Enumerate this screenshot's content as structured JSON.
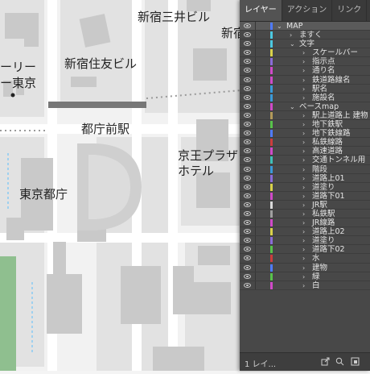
{
  "map": {
    "labels": {
      "mitsui": "新宿三井ビル",
      "shinjuku_cut": "新宿",
      "sumitomo": "新宿住友ビル",
      "ri_cut": "ーリー",
      "tokyo_cut": "ー東京",
      "station": "都庁前駅",
      "keio_line1": "京王プラザ",
      "keio_line2": "ホテル",
      "tocho": "東京都庁"
    }
  },
  "layers_panel": {
    "tabs": [
      "レイヤー",
      "アクション",
      "リンク"
    ],
    "active_tab": "レイヤー",
    "footer_count": "1 レイ...",
    "rows": [
      {
        "name": "MAP",
        "level": 0,
        "expanded": true,
        "color": "#4f7bff",
        "selected": true
      },
      {
        "name": "ますく",
        "level": 1,
        "expanded": false,
        "color": "#4cc8e0"
      },
      {
        "name": "文字",
        "level": 1,
        "expanded": true,
        "color": "#4cc8e0"
      },
      {
        "name": "スケールバー",
        "level": 2,
        "expanded": false,
        "color": "#d9d14a"
      },
      {
        "name": "指示点",
        "level": 2,
        "expanded": false,
        "color": "#8a6bd8"
      },
      {
        "name": "通り名",
        "level": 2,
        "expanded": false,
        "color": "#d04ac8"
      },
      {
        "name": "鉄道路線名",
        "level": 2,
        "expanded": false,
        "color": "#d04ac8"
      },
      {
        "name": "駅名",
        "level": 2,
        "expanded": false,
        "color": "#3a9ad9"
      },
      {
        "name": "施設名",
        "level": 2,
        "expanded": false,
        "color": "#3a9ad9"
      },
      {
        "name": "ベースmap",
        "level": 1,
        "expanded": true,
        "color": "#d04ac8"
      },
      {
        "name": "駅上道路上 建物",
        "level": 2,
        "expanded": false,
        "color": "#b39a5a"
      },
      {
        "name": "地下鉄駅",
        "level": 2,
        "expanded": false,
        "color": "#58c24b"
      },
      {
        "name": "地下鉄線路",
        "level": 2,
        "expanded": false,
        "color": "#4f7bff"
      },
      {
        "name": "私鉄線路",
        "level": 2,
        "expanded": false,
        "color": "#cc3d3d"
      },
      {
        "name": "高速道路",
        "level": 2,
        "expanded": false,
        "color": "#d04ac8"
      },
      {
        "name": "交通トンネル用",
        "level": 2,
        "expanded": false,
        "color": "#3fc0b8"
      },
      {
        "name": "階段",
        "level": 2,
        "expanded": false,
        "color": "#3a9ad9"
      },
      {
        "name": "道路上01",
        "level": 2,
        "expanded": false,
        "color": "#8a6bd8"
      },
      {
        "name": "道塗り",
        "level": 2,
        "expanded": false,
        "color": "#d9d14a"
      },
      {
        "name": "道路下01",
        "level": 2,
        "expanded": false,
        "color": "#d04ac8"
      },
      {
        "name": "JR駅",
        "level": 2,
        "expanded": false,
        "color": "#d9d9d9"
      },
      {
        "name": "私鉄駅",
        "level": 2,
        "expanded": false,
        "color": "#a0a0a0"
      },
      {
        "name": "JR線路",
        "level": 2,
        "expanded": false,
        "color": "#d04ac8"
      },
      {
        "name": "道路上02",
        "level": 2,
        "expanded": false,
        "color": "#d9d14a"
      },
      {
        "name": "道塗り",
        "level": 2,
        "expanded": false,
        "color": "#8a6bd8"
      },
      {
        "name": "道路下02",
        "level": 2,
        "expanded": false,
        "color": "#58c24b"
      },
      {
        "name": "水",
        "level": 2,
        "expanded": false,
        "color": "#cc3d3d"
      },
      {
        "name": "建物",
        "level": 2,
        "expanded": false,
        "color": "#4f7bff"
      },
      {
        "name": "緑",
        "level": 2,
        "expanded": false,
        "color": "#58c24b"
      },
      {
        "name": "白",
        "level": 2,
        "expanded": false,
        "color": "#d04ac8"
      }
    ]
  }
}
